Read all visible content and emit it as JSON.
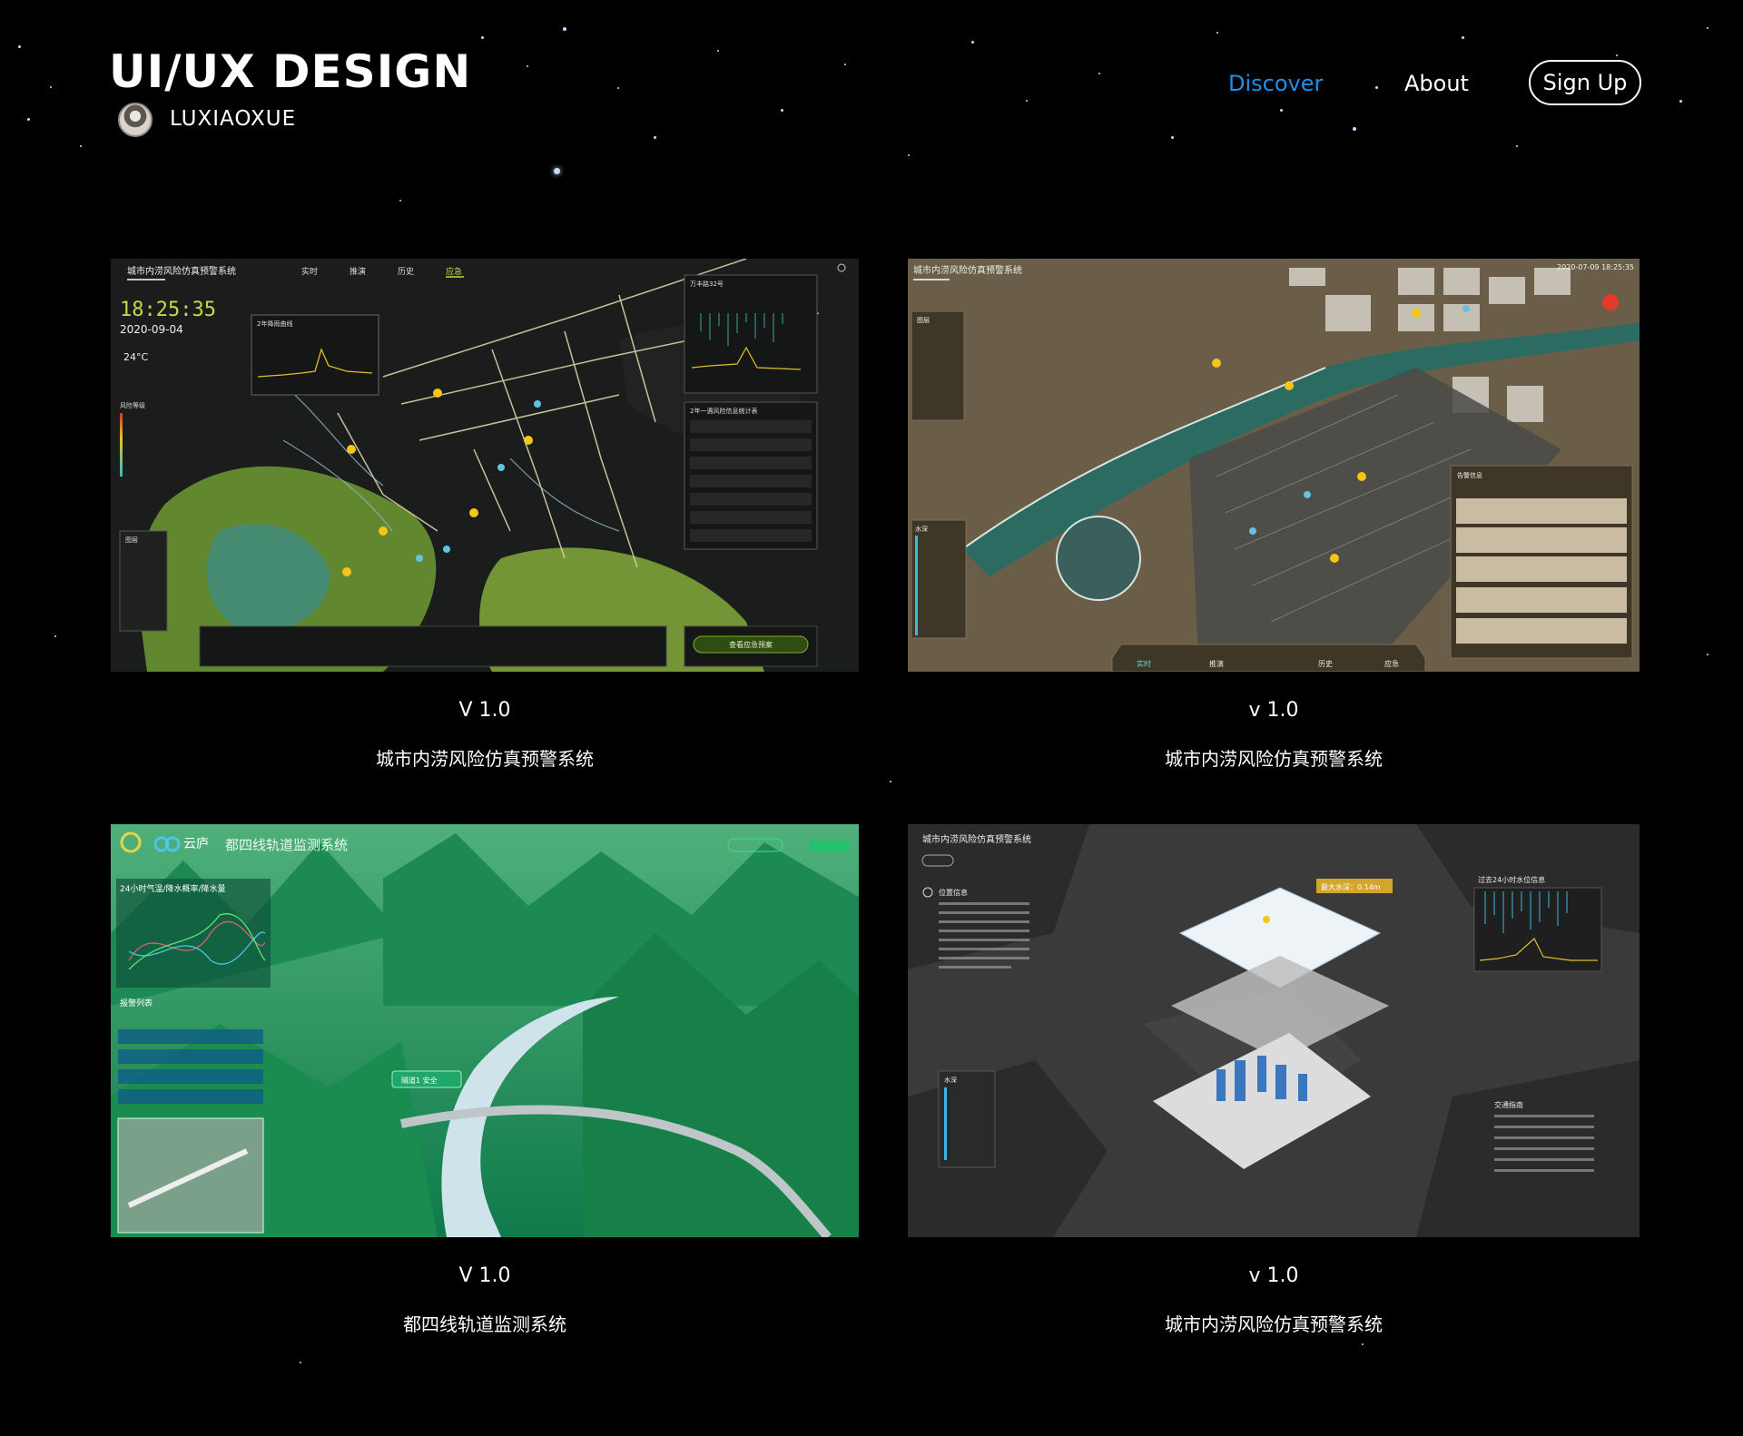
{
  "header": {
    "title": "UI/UX DESIGN",
    "author": "LUXIAOXUE"
  },
  "nav": {
    "discover": "Discover",
    "about": "About",
    "signup": "Sign Up",
    "active_color": "#1e90e6"
  },
  "projects": [
    {
      "version": "V 1.0",
      "title": "城市内涝风险仿真预警系统",
      "screen": {
        "system_name": "城市内涝风险仿真预警系统",
        "tabs": [
          "实时",
          "推演",
          "历史",
          "应急"
        ],
        "time": "18:25:35",
        "date": "2020-09-04",
        "temperature": "24°C",
        "chart_title": "2年降雨曲线",
        "panel_location": "万丰路32号",
        "table_title": "2年一遇风险信息统计表",
        "legend_title": "风险等级",
        "layers_title": "图层",
        "action_button": "查看应急预案"
      }
    },
    {
      "version": "v 1.0",
      "title": "城市内涝风险仿真预警系统",
      "screen": {
        "system_name": "城市内涝风险仿真预警系统",
        "datetime": "2020-07-09  18:25:35",
        "layers_title": "图层",
        "depth_title": "水深",
        "alert_title": "告警信息",
        "bottom_tabs": [
          "实时",
          "推演",
          "历史",
          "应急"
        ]
      }
    },
    {
      "version": "V 1.0",
      "title": "都四线轨道监测系统",
      "screen": {
        "brand": "云庐",
        "system_name": "都四线轨道监测系统",
        "weather_title": "24小时气温/降水概率/降水量",
        "alarm_title": "报警列表",
        "tunnel_tag": "隧道1 安全"
      }
    },
    {
      "version": "v 1.0",
      "title": "城市内涝风险仿真预警系统",
      "screen": {
        "system_name": "城市内涝风险仿真预警系统",
        "location_title": "位置信息",
        "max_depth": "最大水深：0.14m",
        "water_chart_title": "过去24小时水位信息",
        "depth_title": "水深",
        "traffic_title": "交通指南"
      }
    }
  ]
}
